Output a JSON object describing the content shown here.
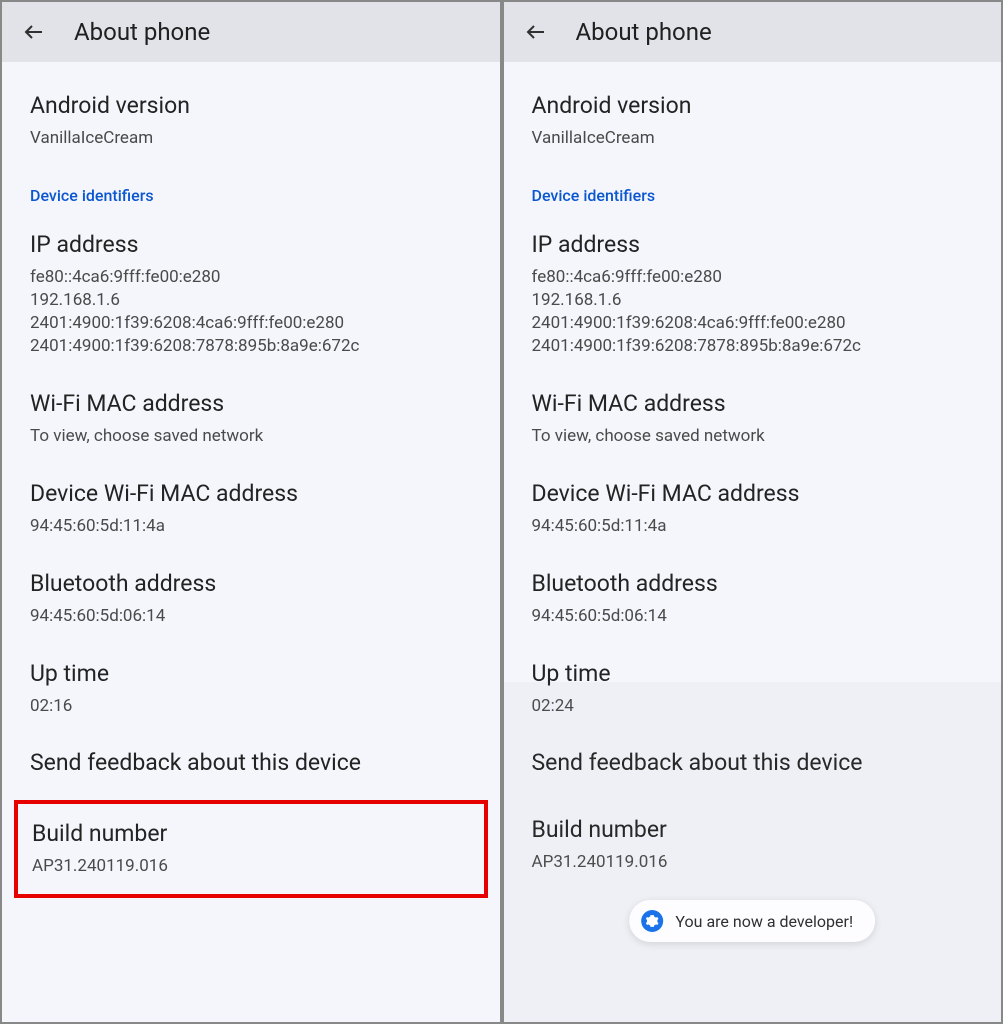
{
  "left": {
    "header": {
      "title": "About phone"
    },
    "androidVersion": {
      "label": "Android version",
      "value": "VanillaIceCream"
    },
    "category": "Device identifiers",
    "ip": {
      "label": "IP address",
      "value": "fe80::4ca6:9fff:fe00:e280\n192.168.1.6\n2401:4900:1f39:6208:4ca6:9fff:fe00:e280\n2401:4900:1f39:6208:7878:895b:8a9e:672c"
    },
    "wifiMac": {
      "label": "Wi-Fi MAC address",
      "value": "To view, choose saved network"
    },
    "deviceWifiMac": {
      "label": "Device Wi-Fi MAC address",
      "value": "94:45:60:5d:11:4a"
    },
    "bluetooth": {
      "label": "Bluetooth address",
      "value": "94:45:60:5d:06:14"
    },
    "uptime": {
      "label": "Up time",
      "value": "02:16"
    },
    "feedback": "Send feedback about this device",
    "build": {
      "label": "Build number",
      "value": "AP31.240119.016"
    }
  },
  "right": {
    "header": {
      "title": "About phone"
    },
    "androidVersion": {
      "label": "Android version",
      "value": "VanillaIceCream"
    },
    "category": "Device identifiers",
    "ip": {
      "label": "IP address",
      "value": "fe80::4ca6:9fff:fe00:e280\n192.168.1.6\n2401:4900:1f39:6208:4ca6:9fff:fe00:e280\n2401:4900:1f39:6208:7878:895b:8a9e:672c"
    },
    "wifiMac": {
      "label": "Wi-Fi MAC address",
      "value": "To view, choose saved network"
    },
    "deviceWifiMac": {
      "label": "Device Wi-Fi MAC address",
      "value": "94:45:60:5d:11:4a"
    },
    "bluetooth": {
      "label": "Bluetooth address",
      "value": "94:45:60:5d:06:14"
    },
    "uptime": {
      "label": "Up time",
      "value": "02:24"
    },
    "feedback": "Send feedback about this device",
    "build": {
      "label": "Build number",
      "value": "AP31.240119.016"
    },
    "toast": "You are now a developer!"
  }
}
